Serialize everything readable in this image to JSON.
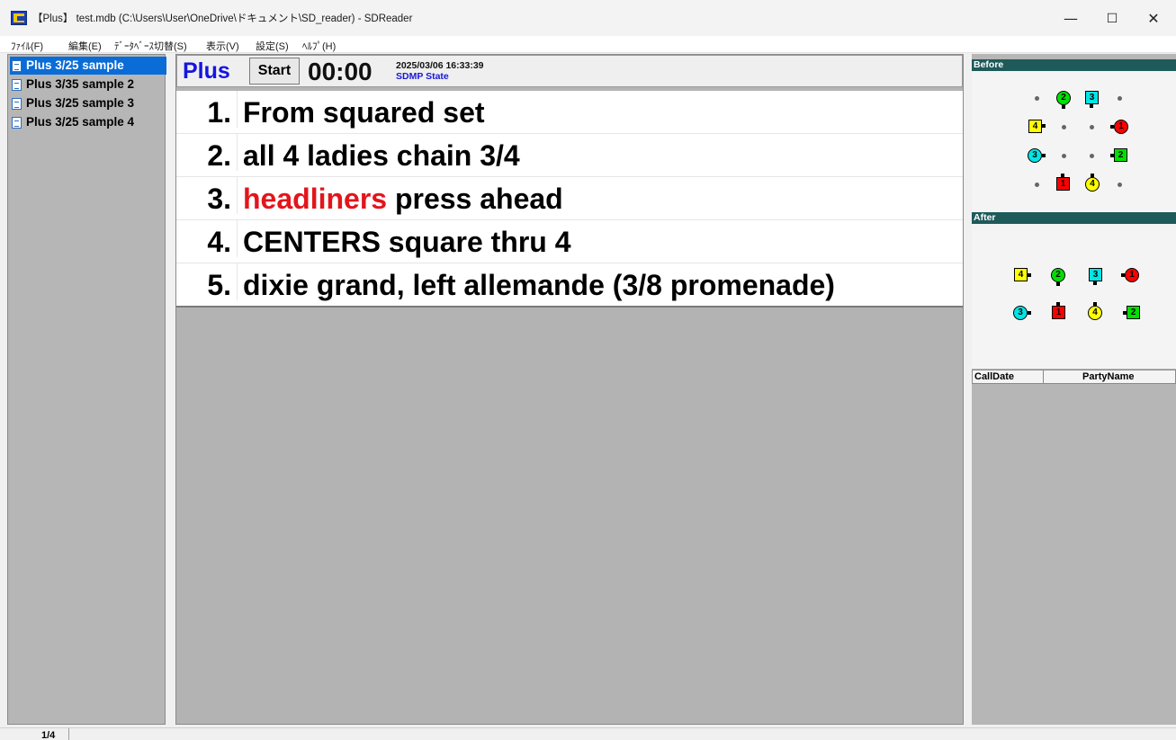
{
  "window": {
    "title": "【Plus】 test.mdb (C:\\Users\\User\\OneDrive\\ドキュメント\\SD_reader) - SDReader",
    "minimize": "—",
    "maximize": "☐",
    "close": "✕"
  },
  "menu": {
    "items": [
      "ﾌｧｲﾙ(F)",
      "編集(E)",
      "ﾃﾞｰﾀﾍﾞｰｽ切替(S)",
      "表示(V)",
      "設定(S)",
      "ﾍﾙﾌﾟ(H)"
    ]
  },
  "sequences": {
    "items": [
      "Plus 3/25 sample",
      "Plus 3/35 sample 2",
      "Plus 3/25 sample 3",
      "Plus 3/25 sample 4"
    ],
    "selected_index": 0
  },
  "header": {
    "level": "Plus",
    "start_label": "Start",
    "timer": "00:00",
    "datetime": "2025/03/06 16:33:39",
    "state": "SDMP State"
  },
  "calls": [
    {
      "num": "1.",
      "pre": "",
      "hl": "",
      "text": "From squared set"
    },
    {
      "num": "2.",
      "pre": "",
      "hl": "",
      "text": "all 4 ladies chain 3/4"
    },
    {
      "num": "3.",
      "pre": "",
      "hl": "headliners",
      "text": " press ahead"
    },
    {
      "num": "4.",
      "pre": "",
      "hl": "",
      "text": "CENTERS square thru 4"
    },
    {
      "num": "5.",
      "pre": "",
      "hl": "",
      "text": "dixie grand, left allemande  (3/8 promenade)"
    }
  ],
  "right": {
    "before_label": "Before",
    "after_label": "After",
    "col_calldate": "CallDate",
    "col_partyname": "PartyName"
  },
  "status": {
    "page": "1/4"
  },
  "colors": {
    "level_blue": "#1515e0",
    "highlight_red": "#e3151b",
    "selected_blue": "#0a6cd6",
    "section_teal": "#1f5a5a"
  }
}
